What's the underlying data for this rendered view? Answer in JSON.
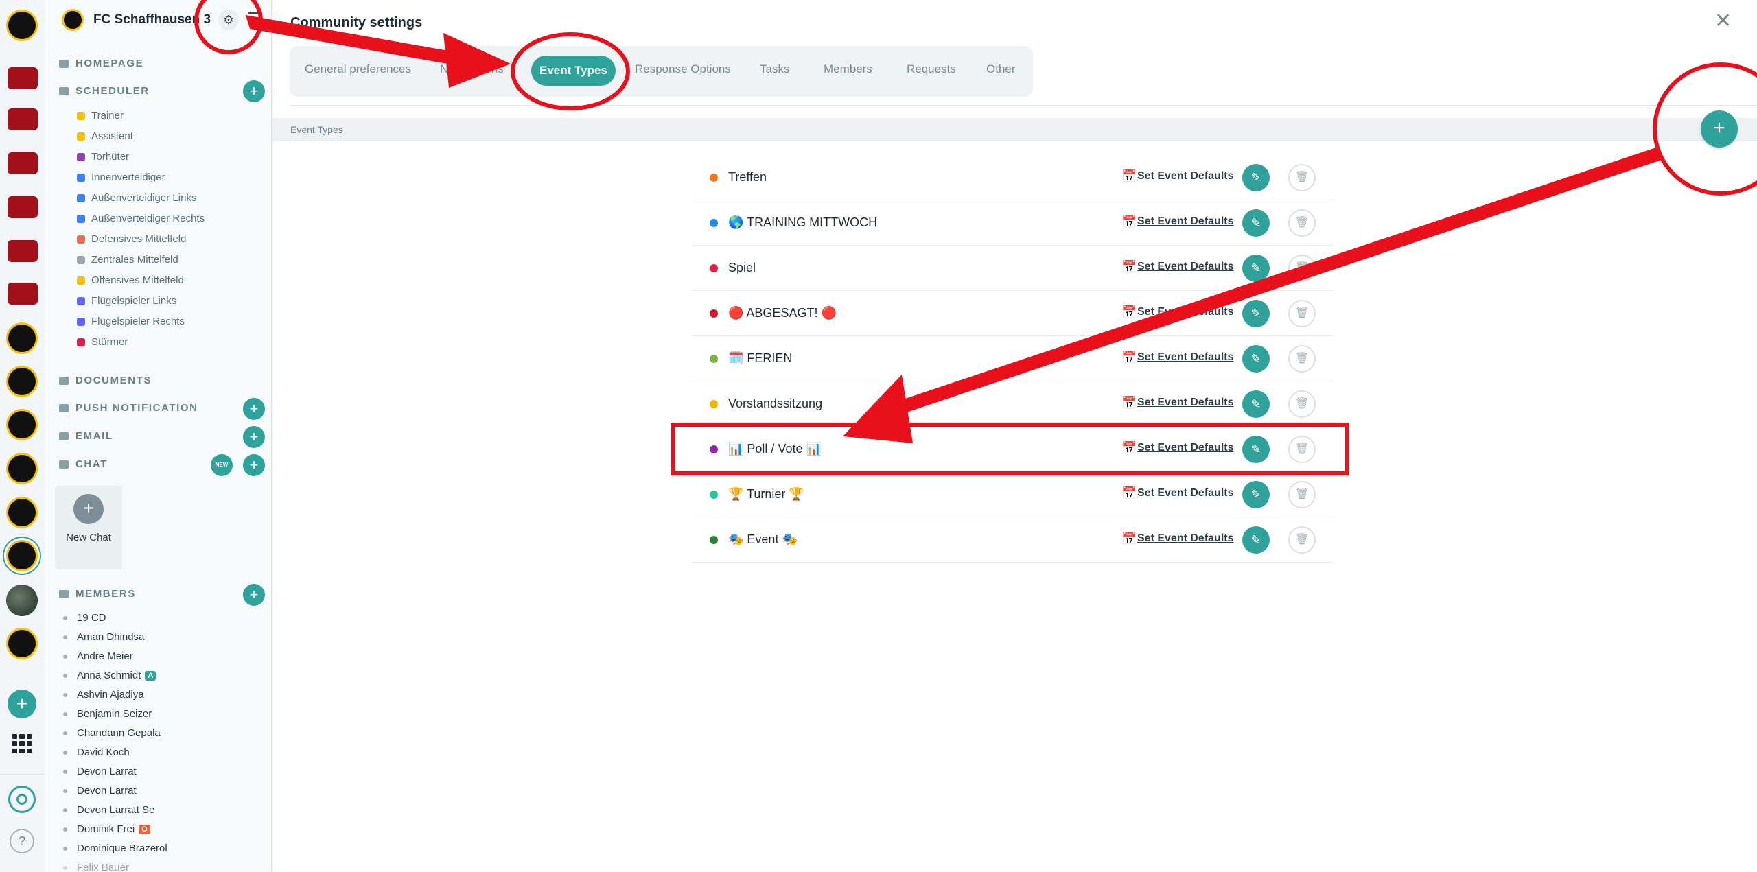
{
  "sidebar": {
    "community_name": "FC Schaffhausen 3",
    "sections": {
      "homepage": "HOMEPAGE",
      "scheduler": "SCHEDULER",
      "documents": "DOCUMENTS",
      "push": "PUSH NOTIFICATION",
      "email": "EMAIL",
      "chat": "CHAT",
      "members": "MEMBERS"
    },
    "new_badge": "NEW",
    "scheduler_items": [
      {
        "label": "Trainer",
        "color": "#f4c20d"
      },
      {
        "label": "Assistent",
        "color": "#f4c20d"
      },
      {
        "label": "Torhüter",
        "color": "#8e44ad"
      },
      {
        "label": "Innenverteidiger",
        "color": "#3b82f6"
      },
      {
        "label": "Außenverteidiger Links",
        "color": "#3b82f6"
      },
      {
        "label": "Außenverteidiger Rechts",
        "color": "#3b82f6"
      },
      {
        "label": "Defensives Mittelfeld",
        "color": "#e76f51"
      },
      {
        "label": "Zentrales Mittelfeld",
        "color": "#9aa7b0"
      },
      {
        "label": "Offensives Mittelfeld",
        "color": "#f4c20d"
      },
      {
        "label": "Flügelspieler Links",
        "color": "#6366f1"
      },
      {
        "label": "Flügelspieler Rechts",
        "color": "#6366f1"
      },
      {
        "label": "Stürmer",
        "color": "#e11d48"
      }
    ],
    "new_chat": "New Chat",
    "members": [
      {
        "name": "19 CD"
      },
      {
        "name": "Aman Dhindsa"
      },
      {
        "name": "Andre Meier"
      },
      {
        "name": "Anna Schmidt",
        "tag": "A",
        "tag_color": "#2ea29b"
      },
      {
        "name": "Ashvin Ajadiya"
      },
      {
        "name": "Benjamin Seizer"
      },
      {
        "name": "Chandann Gepala"
      },
      {
        "name": "David Koch"
      },
      {
        "name": "Devon Larrat"
      },
      {
        "name": "Devon Larrat"
      },
      {
        "name": "Devon Larratt Se"
      },
      {
        "name": "Dominik Frei",
        "tag": "O",
        "tag_color": "#e8643a"
      },
      {
        "name": "Dominique Brazerol"
      },
      {
        "name": "Felix Bauer"
      }
    ]
  },
  "main": {
    "title": "Community settings",
    "tabs": [
      {
        "label": "General preferences"
      },
      {
        "label": "Notifications"
      },
      {
        "label": "Event Types",
        "active": true
      },
      {
        "label": "Response Options"
      },
      {
        "label": "Tasks"
      },
      {
        "label": "Members"
      },
      {
        "label": "Requests"
      },
      {
        "label": "Other"
      }
    ],
    "section_label": "Event Types",
    "set_defaults_label": "Set Event Defaults",
    "event_types": [
      {
        "name": "Treffen",
        "color": "#f97316"
      },
      {
        "name": "🌎 TRAINING MITTWOCH",
        "color": "#1e88e5"
      },
      {
        "name": "Spiel",
        "color": "#e11d48"
      },
      {
        "name": "🔴 ABGESAGT! 🔴",
        "color": "#d11a2a"
      },
      {
        "name": "🗓️ FERIEN",
        "color": "#7cb342"
      },
      {
        "name": "Vorstandssitzung",
        "color": "#f4b400"
      },
      {
        "name": "📊 Poll / Vote 📊",
        "color": "#8e24aa"
      },
      {
        "name": "🏆 Turnier 🏆",
        "color": "#26c6a0"
      },
      {
        "name": "🎭 Event 🎭",
        "color": "#2e7d32"
      }
    ]
  }
}
